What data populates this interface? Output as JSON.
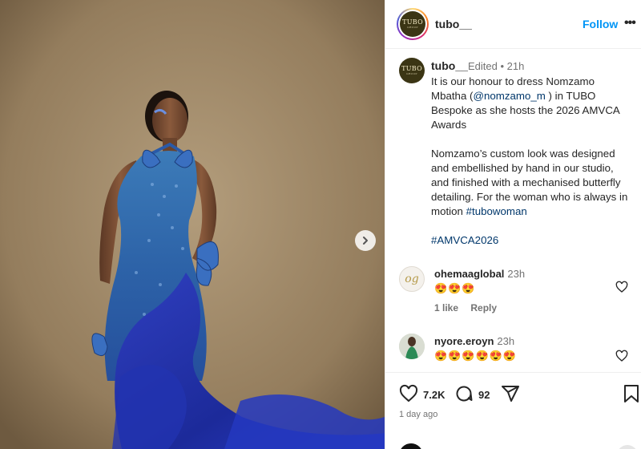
{
  "post": {
    "username": "tubo__",
    "follow_label": "Follow",
    "more_label": "•••",
    "avatar_text": "TUBO",
    "avatar_subtext": "GROUP",
    "next_icon": "chevron-right-icon"
  },
  "caption": {
    "username": "tubo__",
    "meta": "Edited • 21h",
    "line_1": "It is our honour to dress Nomzamo Mbatha (",
    "mention": "@nomzamo_m",
    "line_2": " ) in TUBO Bespoke as she hosts the 2026 AMVCA Awards",
    "paragraph_2": "Nomzamo’s custom look was designed and embellished by hand in our studio, and finished with a mechanised butterfly detailing. For the woman who is always in motion  ",
    "hashtag_1": "#tubowoman",
    "hashtag_2": "#AMVCA2026"
  },
  "comments": [
    {
      "username": "ohemaaglobal",
      "time": "23h",
      "text": "😍😍😍",
      "likes_label": "1 like",
      "reply_label": "Reply",
      "avatar_icon": "og-monogram-avatar"
    },
    {
      "username": "nyore.eroyn",
      "time": "23h",
      "text": "😍😍😍😍😍😍",
      "avatar_icon": "photo-avatar"
    }
  ],
  "actions": {
    "likes_count": "7.2K",
    "comments_count": "92",
    "date": "1 day ago"
  },
  "colors": {
    "accent": "#0095f6",
    "dress_blue": "#1f3fa8",
    "background_photo": "#9c8666"
  }
}
